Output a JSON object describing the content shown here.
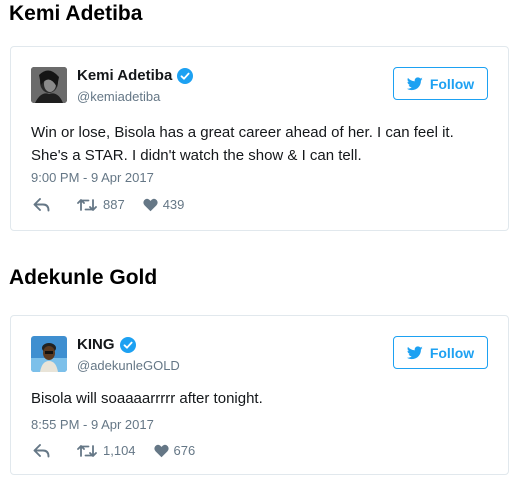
{
  "sections": [
    {
      "heading": "Kemi Adetiba",
      "tweet": {
        "display_name": "Kemi Adetiba",
        "handle": "@kemiadetiba",
        "verified": true,
        "follow_label": "Follow",
        "text": "Win or lose, Bisola has a great career ahead of her. I can feel it. She's a STAR. I didn't watch the show & I can tell.",
        "timestamp": "9:00 PM - 9 Apr 2017",
        "retweets": "887",
        "likes": "439",
        "avatar_icon": "profile-photo-woman"
      }
    },
    {
      "heading": "Adekunle Gold",
      "tweet": {
        "display_name": "KING",
        "handle": "@adekunleGOLD",
        "verified": true,
        "follow_label": "Follow",
        "text": "Bisola will soaaaarrrrr after tonight.",
        "timestamp": "8:55 PM - 9 Apr 2017",
        "retweets": "1,104",
        "likes": "676",
        "avatar_icon": "profile-photo-man"
      }
    }
  ],
  "colors": {
    "twitter_blue": "#1da1f2",
    "muted_text": "#657786",
    "card_border": "#e1e8ed",
    "verified_badge": "#1da1f2"
  },
  "icons": {
    "reply": "reply-icon",
    "retweet": "retweet-icon",
    "like": "heart-icon",
    "follow": "twitter-bird-icon",
    "verified": "verified-badge-icon"
  }
}
